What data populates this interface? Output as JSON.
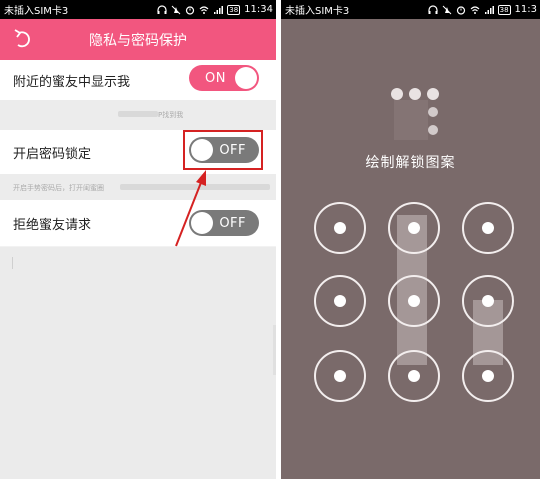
{
  "left": {
    "status": {
      "carrier": "未插入SIM卡3",
      "battery": "38",
      "time": "11:34"
    },
    "header": {
      "title": "隐私与密码保护"
    },
    "settings": [
      {
        "label": "附近的蜜友中显示我",
        "state": "ON"
      },
      {
        "label": "开启密码锁定",
        "state": "OFF"
      },
      {
        "label": "拒绝蜜友请求",
        "state": "OFF"
      }
    ],
    "hints": {
      "nearby": "P找到我",
      "password": "开启手势密码后，打开闺蜜圈"
    }
  },
  "right": {
    "status": {
      "carrier": "未插入SIM卡3",
      "battery": "38",
      "time": "11:3"
    },
    "lock": {
      "title": "绘制解锁图案"
    }
  },
  "colors": {
    "accent": "#f2567f",
    "toggle_off": "#7a7a7a",
    "highlight": "#d52222",
    "lock_bg": "#7a6a6a"
  }
}
